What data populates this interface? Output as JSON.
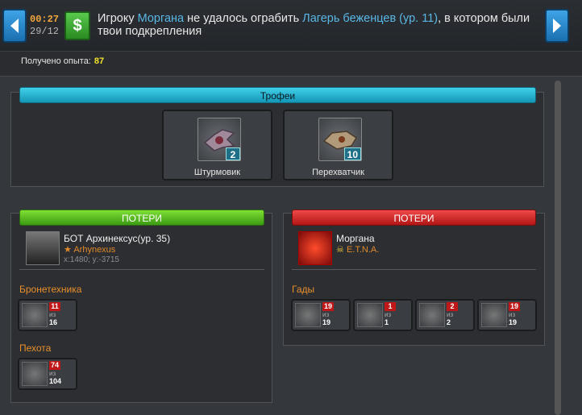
{
  "header": {
    "time": "00:27",
    "date": "29/12",
    "message": {
      "part1": "Игроку ",
      "player": "Моргана",
      "part2": " не удалось ограбить ",
      "target": "Лагерь беженцев (ур. 11)",
      "part3": ", в котором были твои подкрепления"
    },
    "money_icon_glyph": "$"
  },
  "experience": {
    "label": "Получено опыта:",
    "value": "87"
  },
  "trophies": {
    "title": "Трофеи",
    "items": [
      {
        "label": "Штурмовик",
        "count": "2"
      },
      {
        "label": "Перехватчик",
        "count": "10"
      }
    ]
  },
  "left": {
    "title": "ПОТЕРИ",
    "player": {
      "name": "БОТ Архинексус(ур. 35)",
      "alliance": "Arhynexus",
      "coords": "x:1480; y:-3715"
    },
    "sections": [
      {
        "title": "Бронетехника",
        "units": [
          {
            "lost": "11",
            "of": "из",
            "total": "16"
          }
        ]
      },
      {
        "title": "Пехота",
        "units": [
          {
            "lost": "74",
            "of": "из",
            "total": "104"
          }
        ]
      }
    ]
  },
  "right": {
    "title": "ПОТЕРИ",
    "player": {
      "name": "Моргана",
      "alliance": "E.T.N.A."
    },
    "sections": [
      {
        "title": "Гады",
        "units": [
          {
            "lost": "19",
            "of": "из",
            "total": "19"
          },
          {
            "lost": "1",
            "of": "из",
            "total": "1"
          },
          {
            "lost": "2",
            "of": "из",
            "total": "2"
          },
          {
            "lost": "19",
            "of": "из",
            "total": "19"
          }
        ]
      }
    ]
  },
  "colors": {
    "accent_blue": "#59b8e6",
    "exp_yellow": "#f4e32b",
    "alliance_orange": "#e08a2d",
    "loss_red": "#c01818"
  }
}
